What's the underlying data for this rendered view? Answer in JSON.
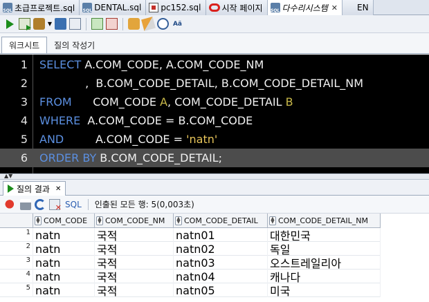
{
  "tabs": [
    {
      "label": "초급프로젝트.sql",
      "icon": "sql-file-icon",
      "active": false
    },
    {
      "label": "DENTAL.sql",
      "icon": "sql-file-icon",
      "active": false
    },
    {
      "label": "pc152.sql",
      "icon": "table-icon",
      "active": false
    },
    {
      "label": "시작 페이지",
      "icon": "oracle-icon",
      "active": false
    },
    {
      "label": "다수리시스템",
      "icon": "sql-file-icon",
      "active": true
    },
    {
      "label": "EN",
      "icon": "grid-icon",
      "active": false
    }
  ],
  "toolbar": {
    "case_label": "Aä"
  },
  "subtabs": [
    {
      "label": "워크시트",
      "active": true
    },
    {
      "label": "질의 작성기",
      "active": false
    }
  ],
  "editor": {
    "lines": [
      {
        "n": "1"
      },
      {
        "n": "2"
      },
      {
        "n": "3"
      },
      {
        "n": "4"
      },
      {
        "n": "5"
      },
      {
        "n": "6"
      }
    ],
    "tokens": {
      "select": "SELECT",
      "l1_rest": " A.COM_CODE, A.COM_CODE_NM",
      "l2": "             ,  B.COM_CODE_DETAIL, B.COM_CODE_DETAIL_NM",
      "from": "FROM",
      "l3_a": "      COM_CODE ",
      "alias_a": "A",
      "l3_b": ", COM_CODE_DETAIL ",
      "alias_b": "B",
      "where": "WHERE",
      "l4_rest": "  A.COM_CODE = B.COM_CODE",
      "and": "AND",
      "l5_rest": "         A.COM_CODE = ",
      "l5_str": "'natn'",
      "order": "ORDER BY",
      "l6_rest": " B.COM_CODE_DETAIL;"
    }
  },
  "result": {
    "tab_label": "질의 결과",
    "sql_label": "SQL",
    "status": "인출된 모든 행: 5(0,003초)",
    "columns": [
      "COM_CODE",
      "COM_CODE_NM",
      "COM_CODE_DETAIL",
      "COM_CODE_DETAIL_NM"
    ],
    "rows": [
      {
        "n": "1",
        "cells": [
          "natn",
          "국적",
          "natn01",
          "대한민국"
        ]
      },
      {
        "n": "2",
        "cells": [
          "natn",
          "국적",
          "natn02",
          "독일"
        ]
      },
      {
        "n": "3",
        "cells": [
          "natn",
          "국적",
          "natn03",
          "오스트레일리아"
        ]
      },
      {
        "n": "4",
        "cells": [
          "natn",
          "국적",
          "natn04",
          "캐나다"
        ]
      },
      {
        "n": "5",
        "cells": [
          "natn",
          "국적",
          "natn05",
          "미국"
        ]
      }
    ]
  }
}
